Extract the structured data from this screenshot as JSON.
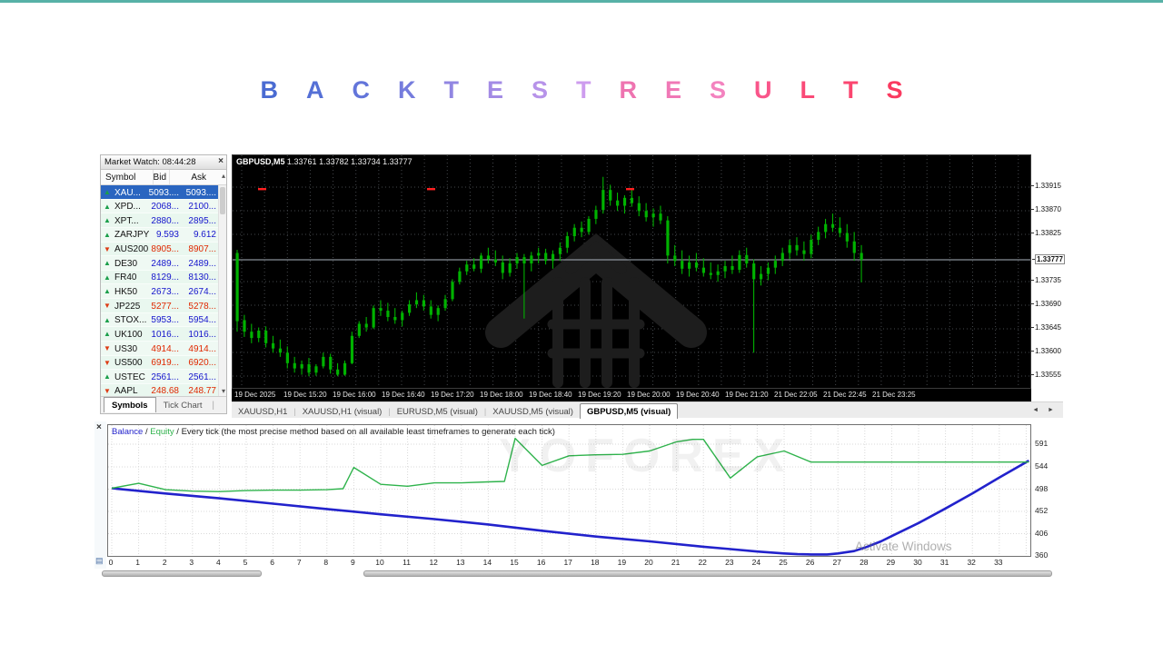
{
  "title": {
    "text": "BACK TEST RESULTS",
    "letters": [
      {
        "ch": "B",
        "color": "#4a6bd2"
      },
      {
        "ch": "A",
        "color": "#5570d6"
      },
      {
        "ch": "C",
        "color": "#6375da"
      },
      {
        "ch": "K",
        "color": "#757cdd"
      },
      {
        "ch": "T",
        "color": "#9186e2"
      },
      {
        "ch": "E",
        "color": "#a38be5"
      },
      {
        "ch": "S",
        "color": "#b793e9"
      },
      {
        "ch": "T",
        "color": "#cd9cee"
      },
      {
        "ch": "R",
        "color": "#ee74b0"
      },
      {
        "ch": "E",
        "color": "#f078b6"
      },
      {
        "ch": "S",
        "color": "#f383bf"
      },
      {
        "ch": "U",
        "color": "#f9558a"
      },
      {
        "ch": "L",
        "color": "#fa4a77"
      },
      {
        "ch": "T",
        "color": "#fb4670"
      },
      {
        "ch": "S",
        "color": "#fa3a60"
      }
    ]
  },
  "icons": {
    "close": "×",
    "arrow_up": "▲",
    "arrow_down": "▼",
    "scroll_up": "▴",
    "scroll_down": "▾",
    "tab_left": "◄",
    "tab_right": "►",
    "journal": "▤"
  },
  "market_watch": {
    "title": "Market Watch: 08:44:28",
    "columns": [
      "Symbol",
      "Bid",
      "Ask"
    ],
    "rows": [
      {
        "symbol": "XAU...",
        "bid": "5093....",
        "ask": "5093....",
        "dir": "up",
        "selected": true
      },
      {
        "symbol": "XPD...",
        "bid": "2068...",
        "ask": "2100...",
        "dir": "up",
        "selected": false
      },
      {
        "symbol": "XPT...",
        "bid": "2880...",
        "ask": "2895...",
        "dir": "up",
        "selected": false
      },
      {
        "symbol": "ZARJPY",
        "bid": "9.593",
        "ask": "9.612",
        "dir": "up",
        "selected": false
      },
      {
        "symbol": "AUS200",
        "bid": "8905...",
        "ask": "8907...",
        "dir": "down",
        "selected": false
      },
      {
        "symbol": "DE30",
        "bid": "2489...",
        "ask": "2489...",
        "dir": "up",
        "selected": false
      },
      {
        "symbol": "FR40",
        "bid": "8129...",
        "ask": "8130...",
        "dir": "up",
        "selected": false
      },
      {
        "symbol": "HK50",
        "bid": "2673...",
        "ask": "2674...",
        "dir": "up",
        "selected": false
      },
      {
        "symbol": "JP225",
        "bid": "5277...",
        "ask": "5278...",
        "dir": "down",
        "selected": false
      },
      {
        "symbol": "STOX...",
        "bid": "5953...",
        "ask": "5954...",
        "dir": "up",
        "selected": false
      },
      {
        "symbol": "UK100",
        "bid": "1016...",
        "ask": "1016...",
        "dir": "up",
        "selected": false
      },
      {
        "symbol": "US30",
        "bid": "4914...",
        "ask": "4914...",
        "dir": "down",
        "selected": false
      },
      {
        "symbol": "US500",
        "bid": "6919...",
        "ask": "6920...",
        "dir": "down",
        "selected": false
      },
      {
        "symbol": "USTEC",
        "bid": "2561...",
        "ask": "2561...",
        "dir": "up",
        "selected": false
      },
      {
        "symbol": "AAPL",
        "bid": "248.68",
        "ask": "248.77",
        "dir": "down",
        "selected": false
      }
    ],
    "tabs": [
      "Symbols",
      "Tick Chart"
    ],
    "active_tab": "Symbols"
  },
  "chart": {
    "symbol_tf": "GBPUSD,M5",
    "ohlc_text": "1.33761 1.33782 1.33734 1.33777",
    "current_price": "1.33777",
    "price_scale": [
      [
        "1.33915",
        35
      ],
      [
        "1.33870",
        61
      ],
      [
        "1.33825",
        87
      ],
      [
        "1.33777",
        115
      ],
      [
        "1.33735",
        139
      ],
      [
        "1.33690",
        165
      ],
      [
        "1.33645",
        191
      ],
      [
        "1.33600",
        217
      ],
      [
        "1.33555",
        243
      ]
    ],
    "time_labels": [
      [
        "19 Dec 2025",
        3
      ],
      [
        "19 Dec 15:20",
        57
      ],
      [
        "19 Dec 16:00",
        111
      ],
      [
        "19 Dec 16:40",
        165
      ],
      [
        "19 Dec 17:20",
        219
      ],
      [
        "19 Dec 18:00",
        273
      ],
      [
        "19 Dec 18:40",
        327
      ],
      [
        "19 Dec 19:20",
        381
      ],
      [
        "19 Dec 20:00",
        435
      ],
      [
        "19 Dec 20:40",
        489
      ],
      [
        "19 Dec 21:20",
        543
      ],
      [
        "21 Dec 22:05",
        597
      ],
      [
        "21 Dec 22:45",
        651
      ],
      [
        "21 Dec 23:25",
        705
      ]
    ],
    "tabs": [
      "XAUUSD,H1",
      "XAUUSD,H1 (visual)",
      "EURUSD,M5 (visual)",
      "XAUUSD,M5 (visual)",
      "GBPUSD,M5 (visual)"
    ],
    "active_tab": "GBPUSD,M5 (visual)",
    "sell_marks_x": [
      32,
      218,
      437
    ],
    "colors": {
      "candle": "#00b200",
      "grid": "#44474b",
      "price_line": "#aab4be",
      "mark": "#ff2020",
      "bg": "#000000"
    }
  },
  "chart_data": [
    {
      "type": "candlestick",
      "title": "GBPUSD,M5",
      "note": "values are 1.33xxx in units of 0.00001, format [high,low,open,close]",
      "candles": [
        [
          796,
          640,
          790,
          660
        ],
        [
          672,
          630,
          662,
          640
        ],
        [
          655,
          618,
          640,
          628
        ],
        [
          648,
          620,
          628,
          642
        ],
        [
          650,
          610,
          642,
          618
        ],
        [
          632,
          600,
          618,
          608
        ],
        [
          625,
          592,
          608,
          600
        ],
        [
          612,
          570,
          600,
          580
        ],
        [
          592,
          562,
          580,
          570
        ],
        [
          585,
          558,
          570,
          578
        ],
        [
          590,
          555,
          578,
          562
        ],
        [
          578,
          556,
          562,
          574
        ],
        [
          600,
          570,
          574,
          592
        ],
        [
          598,
          560,
          592,
          568
        ],
        [
          580,
          555,
          568,
          558
        ],
        [
          585,
          556,
          558,
          580
        ],
        [
          640,
          578,
          580,
          632
        ],
        [
          660,
          628,
          632,
          655
        ],
        [
          668,
          640,
          655,
          648
        ],
        [
          690,
          645,
          648,
          685
        ],
        [
          700,
          670,
          685,
          680
        ],
        [
          695,
          660,
          680,
          668
        ],
        [
          685,
          655,
          668,
          662
        ],
        [
          680,
          650,
          662,
          676
        ],
        [
          700,
          670,
          676,
          692
        ],
        [
          715,
          685,
          692,
          700
        ],
        [
          710,
          680,
          700,
          688
        ],
        [
          700,
          665,
          688,
          672
        ],
        [
          690,
          660,
          672,
          685
        ],
        [
          710,
          680,
          685,
          702
        ],
        [
          740,
          698,
          702,
          735
        ],
        [
          762,
          730,
          735,
          755
        ],
        [
          775,
          748,
          755,
          768
        ],
        [
          780,
          755,
          768,
          760
        ],
        [
          790,
          752,
          760,
          785
        ],
        [
          800,
          770,
          785,
          778
        ],
        [
          795,
          765,
          778,
          772
        ],
        [
          785,
          740,
          772,
          752
        ],
        [
          780,
          745,
          752,
          770
        ],
        [
          790,
          760,
          770,
          782
        ],
        [
          788,
          665,
          782,
          770
        ],
        [
          792,
          755,
          770,
          785
        ],
        [
          800,
          770,
          785,
          790
        ],
        [
          798,
          768,
          790,
          775
        ],
        [
          795,
          760,
          775,
          788
        ],
        [
          810,
          775,
          788,
          800
        ],
        [
          830,
          790,
          800,
          822
        ],
        [
          845,
          812,
          822,
          838
        ],
        [
          850,
          820,
          838,
          830
        ],
        [
          860,
          825,
          830,
          855
        ],
        [
          880,
          845,
          855,
          872
        ],
        [
          935,
          865,
          872,
          910
        ],
        [
          920,
          880,
          910,
          890
        ],
        [
          905,
          870,
          890,
          880
        ],
        [
          900,
          865,
          880,
          895
        ],
        [
          910,
          878,
          895,
          885
        ],
        [
          898,
          860,
          885,
          870
        ],
        [
          885,
          850,
          870,
          858
        ],
        [
          875,
          840,
          858,
          865
        ],
        [
          880,
          845,
          865,
          852
        ],
        [
          860,
          770,
          852,
          785
        ],
        [
          805,
          765,
          785,
          775
        ],
        [
          795,
          750,
          775,
          760
        ],
        [
          785,
          745,
          760,
          772
        ],
        [
          790,
          755,
          772,
          762
        ],
        [
          780,
          745,
          762,
          752
        ],
        [
          772,
          740,
          752,
          748
        ],
        [
          768,
          735,
          748,
          755
        ],
        [
          775,
          742,
          755,
          765
        ],
        [
          785,
          750,
          765,
          758
        ],
        [
          795,
          752,
          758,
          786
        ],
        [
          800,
          762,
          786,
          770
        ],
        [
          778,
          600,
          770,
          740
        ],
        [
          765,
          728,
          740,
          750
        ],
        [
          772,
          738,
          750,
          762
        ],
        [
          785,
          750,
          762,
          775
        ],
        [
          800,
          765,
          775,
          790
        ],
        [
          815,
          778,
          790,
          805
        ],
        [
          820,
          785,
          805,
          795
        ],
        [
          812,
          775,
          795,
          788
        ],
        [
          825,
          780,
          788,
          815
        ],
        [
          840,
          805,
          815,
          830
        ],
        [
          855,
          818,
          830,
          845
        ],
        [
          865,
          830,
          845,
          838
        ],
        [
          858,
          820,
          838,
          828
        ],
        [
          845,
          800,
          828,
          812
        ],
        [
          830,
          775,
          812,
          790
        ],
        [
          805,
          734,
          790,
          777
        ]
      ]
    },
    {
      "type": "line",
      "title": "Balance / Equity",
      "ylim": [
        360,
        632
      ],
      "xlim": [
        0,
        34.2
      ],
      "series": [
        {
          "name": "Equity",
          "color": "#2fb34c",
          "points": [
            [
              0,
              500
            ],
            [
              1,
              510
            ],
            [
              2,
              497
            ],
            [
              3,
              494
            ],
            [
              4,
              493
            ],
            [
              5,
              495
            ],
            [
              6,
              496
            ],
            [
              7,
              496
            ],
            [
              8,
              497
            ],
            [
              8.6,
              499
            ],
            [
              9,
              543
            ],
            [
              10,
              508
            ],
            [
              11,
              504
            ],
            [
              12,
              511
            ],
            [
              13,
              511
            ],
            [
              14,
              513
            ],
            [
              14.6,
              514
            ],
            [
              15,
              603
            ],
            [
              16,
              547
            ],
            [
              17,
              567
            ],
            [
              18,
              569
            ],
            [
              19,
              570
            ],
            [
              20,
              577
            ],
            [
              21,
              596
            ],
            [
              21.6,
              601
            ],
            [
              22,
              601
            ],
            [
              23,
              521
            ],
            [
              24,
              565
            ],
            [
              25,
              577
            ],
            [
              26,
              554
            ],
            [
              27,
              554
            ],
            [
              28,
              554
            ],
            [
              30,
              554
            ],
            [
              32,
              554
            ],
            [
              34.1,
              554
            ]
          ]
        },
        {
          "name": "Balance",
          "color": "#2222cc",
          "points": [
            [
              0,
              500
            ],
            [
              2,
              489
            ],
            [
              4,
              479
            ],
            [
              6,
              468
            ],
            [
              8,
              457
            ],
            [
              10,
              446
            ],
            [
              12,
              436
            ],
            [
              14,
              425
            ],
            [
              16,
              412
            ],
            [
              18,
              400
            ],
            [
              20,
              390
            ],
            [
              22,
              379
            ],
            [
              23,
              374
            ],
            [
              24,
              369
            ],
            [
              25,
              365
            ],
            [
              25.5,
              363.5
            ],
            [
              26,
              363
            ],
            [
              26.6,
              363
            ],
            [
              27,
              365
            ],
            [
              27.6,
              370
            ],
            [
              28,
              377
            ],
            [
              28.6,
              390
            ],
            [
              29,
              401
            ],
            [
              30,
              428
            ],
            [
              31,
              458
            ],
            [
              32,
              489
            ],
            [
              33,
              522
            ],
            [
              34.1,
              557
            ]
          ]
        }
      ]
    }
  ],
  "tester": {
    "legend": {
      "balance": "Balance",
      "sep1": " / ",
      "equity": "Equity",
      "rest": " / Every tick (the most precise method based on all available least timeframes to generate each tick)"
    },
    "y_labels": [
      "591",
      "544",
      "498",
      "452",
      "406",
      "360"
    ],
    "x_labels": [
      "0",
      "1",
      "2",
      "3",
      "4",
      "5",
      "6",
      "7",
      "8",
      "9",
      "10",
      "11",
      "12",
      "13",
      "14",
      "15",
      "16",
      "17",
      "18",
      "19",
      "20",
      "21",
      "22",
      "23",
      "24",
      "25",
      "26",
      "27",
      "28",
      "29",
      "30",
      "31",
      "32",
      "33"
    ],
    "watermark": "YOFOREX",
    "activate_text": "Activate Windows",
    "grid_color": "#d9d9d9"
  }
}
